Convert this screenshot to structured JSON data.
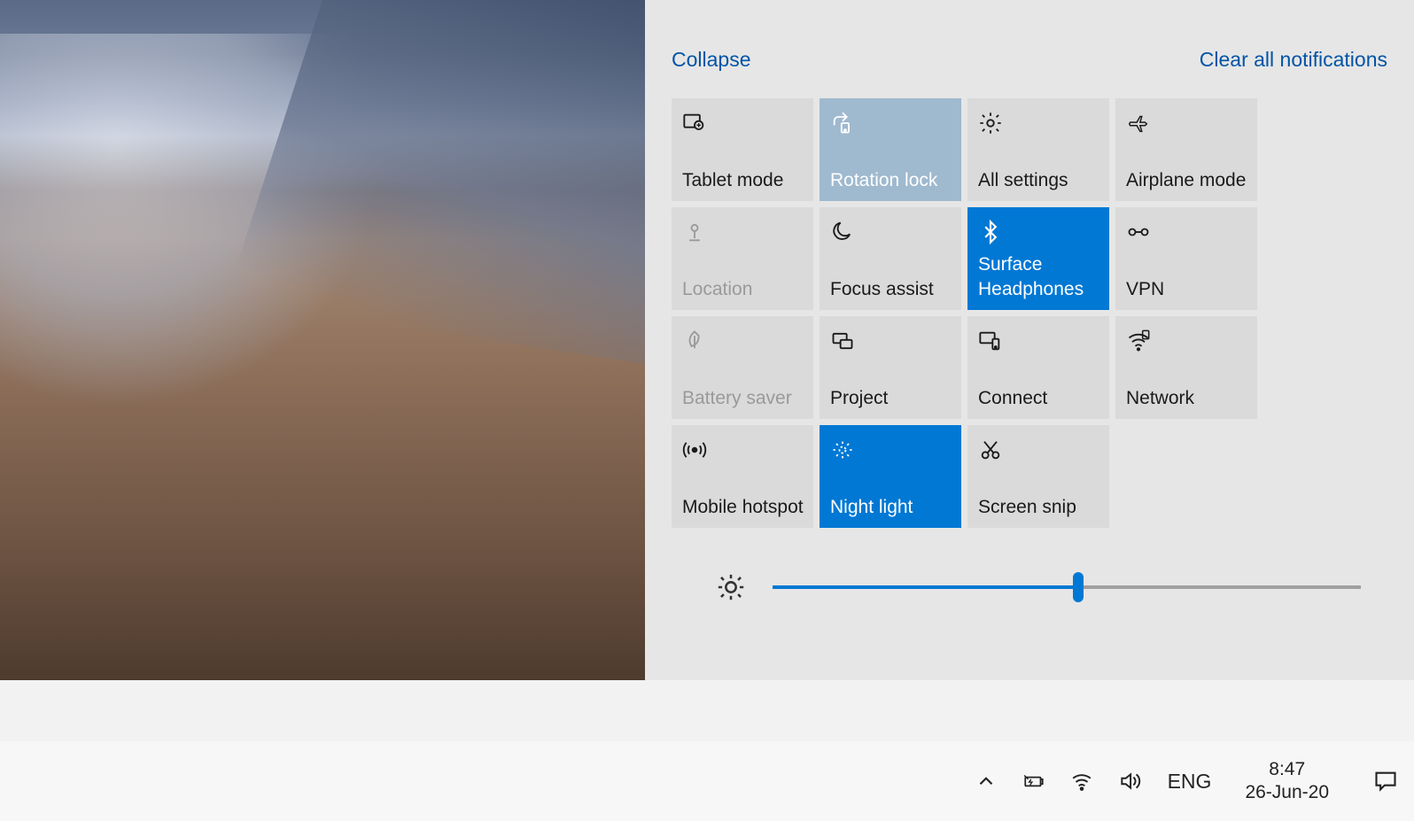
{
  "header": {
    "collapse_label": "Collapse",
    "clear_label": "Clear all notifications"
  },
  "tiles": [
    {
      "id": "tablet-mode",
      "label": "Tablet mode",
      "icon": "tablet-icon",
      "state": "normal"
    },
    {
      "id": "rotation-lock",
      "label": "Rotation lock",
      "icon": "rotation-icon",
      "state": "semi"
    },
    {
      "id": "all-settings",
      "label": "All settings",
      "icon": "gear-icon",
      "state": "normal"
    },
    {
      "id": "airplane-mode",
      "label": "Airplane mode",
      "icon": "airplane-icon",
      "state": "normal"
    },
    {
      "id": "location",
      "label": "Location",
      "icon": "location-icon",
      "state": "disabled"
    },
    {
      "id": "focus-assist",
      "label": "Focus assist",
      "icon": "moon-icon",
      "state": "normal"
    },
    {
      "id": "bluetooth",
      "label": "Surface Headphones",
      "icon": "bluetooth-icon",
      "state": "active"
    },
    {
      "id": "vpn",
      "label": "VPN",
      "icon": "vpn-icon",
      "state": "normal"
    },
    {
      "id": "battery-saver",
      "label": "Battery saver",
      "icon": "leaf-icon",
      "state": "disabled"
    },
    {
      "id": "project",
      "label": "Project",
      "icon": "project-icon",
      "state": "normal"
    },
    {
      "id": "connect",
      "label": "Connect",
      "icon": "connect-icon",
      "state": "normal"
    },
    {
      "id": "network",
      "label": "Network",
      "icon": "wifi-icon",
      "state": "normal"
    },
    {
      "id": "mobile-hotspot",
      "label": "Mobile hotspot",
      "icon": "hotspot-icon",
      "state": "normal"
    },
    {
      "id": "night-light",
      "label": "Night light",
      "icon": "nightlight-icon",
      "state": "active"
    },
    {
      "id": "screen-snip",
      "label": "Screen snip",
      "icon": "snip-icon",
      "state": "normal"
    }
  ],
  "brightness": {
    "percent": 52
  },
  "taskbar": {
    "language": "ENG",
    "time": "8:47",
    "date": "26-Jun-20"
  }
}
